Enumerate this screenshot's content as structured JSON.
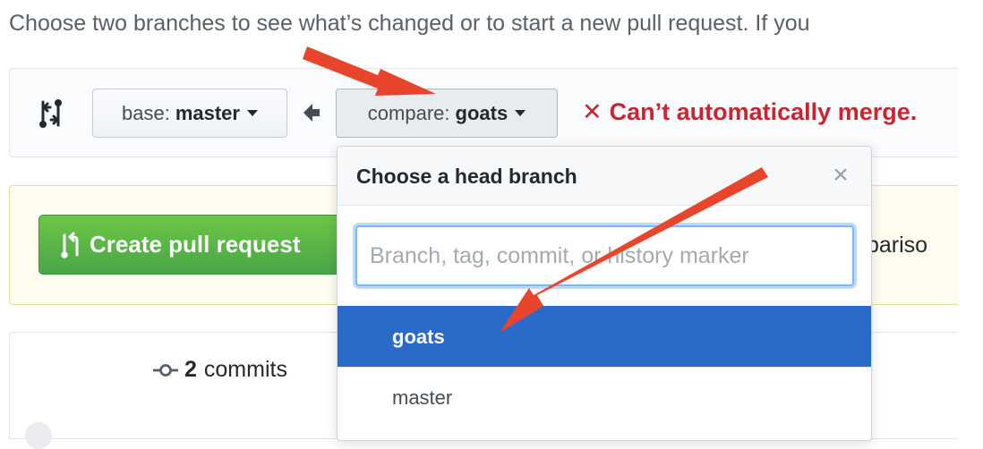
{
  "intro_text": "Choose two branches to see what’s changed or to start a new pull request. If you",
  "range_editor": {
    "base": {
      "prefix": "base:",
      "branch": "master"
    },
    "compare": {
      "prefix": "compare:",
      "branch": "goats"
    },
    "merge_status": "Can’t automatically merge.",
    "merge_status_icon": "✕"
  },
  "create_pr_button": "Create pull request",
  "comparison_fragment": "pariso",
  "stats": {
    "commits_count": "2",
    "commits_label": "commits"
  },
  "branch_dropdown": {
    "title": "Choose a head branch",
    "close_glyph": "×",
    "filter_placeholder": "Branch, tag, commit, or history marker",
    "filter_value": "",
    "branches": [
      "goats",
      "master"
    ],
    "selected_branch": "goats"
  },
  "colors": {
    "accent_blue": "#2a6ac9",
    "merge_error_red": "#cb2431",
    "create_pr_green": "#5cb85c",
    "annotation_arrow": "#e8452c"
  }
}
